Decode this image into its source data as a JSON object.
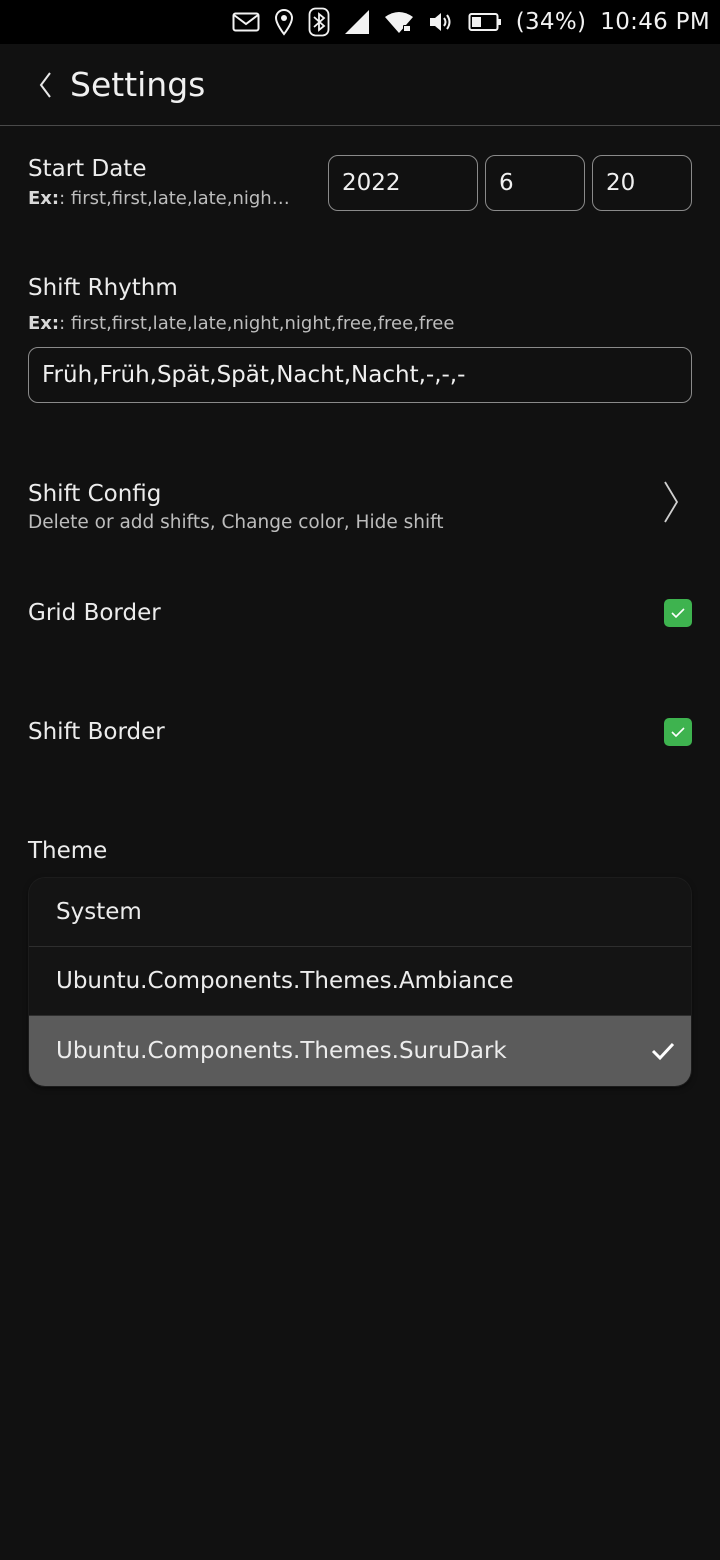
{
  "status_bar": {
    "battery": "(34%)",
    "time": "10:46 PM",
    "icons": [
      "mail-icon",
      "location-icon",
      "bluetooth-icon",
      "cellular-signal-icon",
      "wifi-icon",
      "volume-icon",
      "battery-icon"
    ]
  },
  "header": {
    "title": "Settings",
    "back_icon": "chevron-left-icon"
  },
  "start_date": {
    "label": "Start Date",
    "hint_prefix": "Ex:",
    "hint_text": ": first,first,late,late,nigh…",
    "year": "2022",
    "month": "6",
    "day": "20"
  },
  "shift_rhythm": {
    "label": "Shift Rhythm",
    "hint_prefix": "Ex:",
    "hint_text": ": first,first,late,late,night,night,free,free,free",
    "value": "Früh,Früh,Spät,Spät,Nacht,Nacht,-,-,-"
  },
  "shift_config": {
    "label": "Shift Config",
    "subtitle": "Delete or add shifts, Change color, Hide shift",
    "icon": "chevron-right-icon"
  },
  "grid_border": {
    "label": "Grid Border",
    "checked": true
  },
  "shift_border": {
    "label": "Shift Border",
    "checked": true
  },
  "theme": {
    "label": "Theme",
    "options": [
      "System",
      "Ubuntu.Components.Themes.Ambiance",
      "Ubuntu.Components.Themes.SuruDark"
    ],
    "selected_index": 2
  },
  "colors": {
    "background": "#111111",
    "checkbox_green": "#3eb34f",
    "selected_row": "#5b5b5b"
  }
}
